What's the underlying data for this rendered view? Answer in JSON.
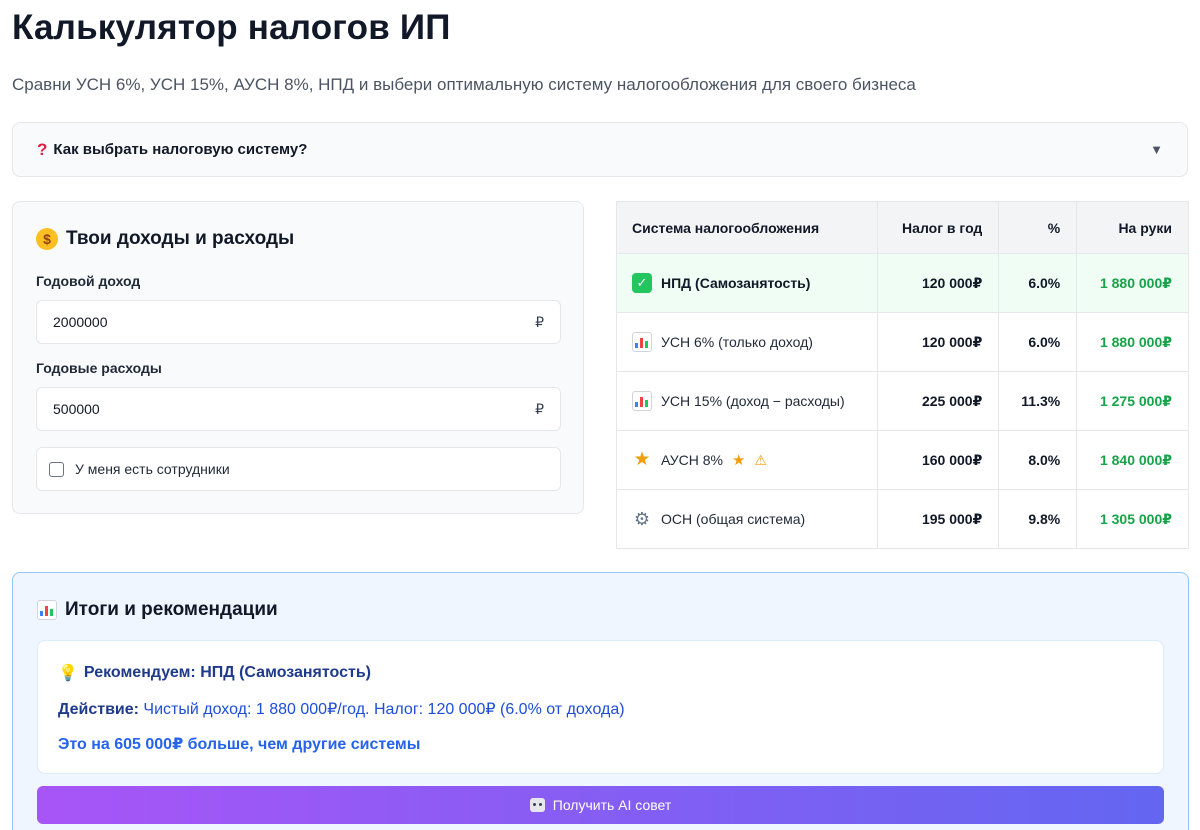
{
  "header": {
    "title": "Калькулятор налогов ИП",
    "subtitle": "Сравни УСН 6%, УСН 15%, АУСН 8%, НПД и выбери оптимальную систему налогообложения для своего бизнеса"
  },
  "faq": {
    "icon": "question-icon",
    "label": "Как выбрать налоговую систему?",
    "chevron": "▼"
  },
  "inputs": {
    "title": "Твои доходы и расходы",
    "title_icon": "money-bag-icon",
    "income_label": "Годовой доход",
    "income_value": "2000000",
    "expenses_label": "Годовые расходы",
    "expenses_value": "500000",
    "currency": "₽",
    "employees_label": "У меня есть сотрудники",
    "employees_checked": false
  },
  "table": {
    "headers": [
      "Система налогообложения",
      "Налог в год",
      "%",
      "На руки"
    ],
    "rows": [
      {
        "icon": "check-icon",
        "name": "НПД (Самозанятость)",
        "tax": "120 000₽",
        "percent": "6.0%",
        "net": "1 880 000₽",
        "best": true
      },
      {
        "icon": "chart-icon",
        "name": "УСН 6% (только доход)",
        "tax": "120 000₽",
        "percent": "6.0%",
        "net": "1 880 000₽",
        "best": false
      },
      {
        "icon": "chart-icon",
        "name": "УСН 15% (доход − расходы)",
        "tax": "225 000₽",
        "percent": "11.3%",
        "net": "1 275 000₽",
        "best": false
      },
      {
        "icon": "star-icon",
        "name": "АУСН 8%",
        "tax": "160 000₽",
        "percent": "8.0%",
        "net": "1 840 000₽",
        "best": false
      },
      {
        "icon": "gear-icon",
        "name": "ОСН (общая система)",
        "tax": "195 000₽",
        "percent": "9.8%",
        "net": "1 305 000₽",
        "best": false
      }
    ],
    "accent_green": "#16a34a",
    "best_row_bg": "#f0fdf4"
  },
  "summary": {
    "title": "Итоги и рекомендации",
    "title_icon": "chart-icon",
    "recommend": "Рекомендуем: НПД (Самозанятость)",
    "action_label": "Действие:",
    "action_text": "Чистый доход: 1 880 000₽/год. Налог: 120 000₽ (6.0% от дохода)",
    "extra": "Это на 605 000₽ больше, чем другие системы",
    "ai_button": "Получить AI совет",
    "ai_button_icon": "robot-icon"
  }
}
